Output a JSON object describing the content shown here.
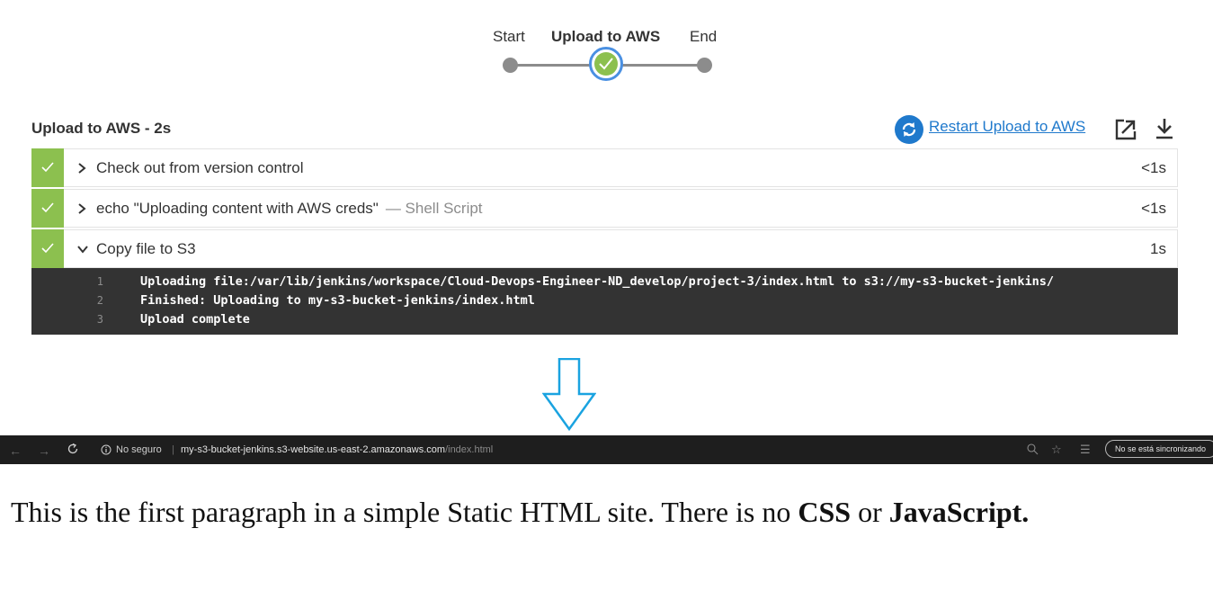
{
  "pipeline": {
    "stages": [
      {
        "label": "Start",
        "status": "success"
      },
      {
        "label": "Upload to AWS",
        "status": "success",
        "selected": true
      },
      {
        "label": "End",
        "status": "success"
      }
    ]
  },
  "stage_header": {
    "title": "Upload to AWS - 2s",
    "restart_label": "Restart Upload to AWS"
  },
  "steps": [
    {
      "label": "Check out from version control",
      "sub": "",
      "duration": "<1s",
      "expanded": false,
      "status": "success"
    },
    {
      "label": "echo \"Uploading content with AWS creds\"",
      "sub": "— Shell Script",
      "duration": "<1s",
      "expanded": false,
      "status": "success"
    },
    {
      "label": "Copy file to S3",
      "sub": "",
      "duration": "1s",
      "expanded": true,
      "status": "success"
    }
  ],
  "console": [
    {
      "n": "1",
      "text": "Uploading file:/var/lib/jenkins/workspace/Cloud-Devops-Engineer-ND_develop/project-3/index.html to s3://my-s3-bucket-jenkins/"
    },
    {
      "n": "2",
      "text": "Finished: Uploading to my-s3-bucket-jenkins/index.html"
    },
    {
      "n": "3",
      "text": "Upload complete"
    }
  ],
  "browser": {
    "security_label": "No seguro",
    "url_host": "my-s3-bucket-jenkins.s3-website.us-east-2.amazonaws.com",
    "url_path": "/index.html",
    "sync_label": "No se está sincronizando"
  },
  "page": {
    "text_before": "This is the first paragraph in a simple Static HTML site. There is no ",
    "bold_1": "CSS",
    "text_mid": " or ",
    "bold_2": "JavaScript."
  },
  "colors": {
    "success_green": "#8cc04f",
    "link_blue": "#1f79cc",
    "console_bg": "#333333",
    "arrow_blue": "#1aa3e0"
  }
}
